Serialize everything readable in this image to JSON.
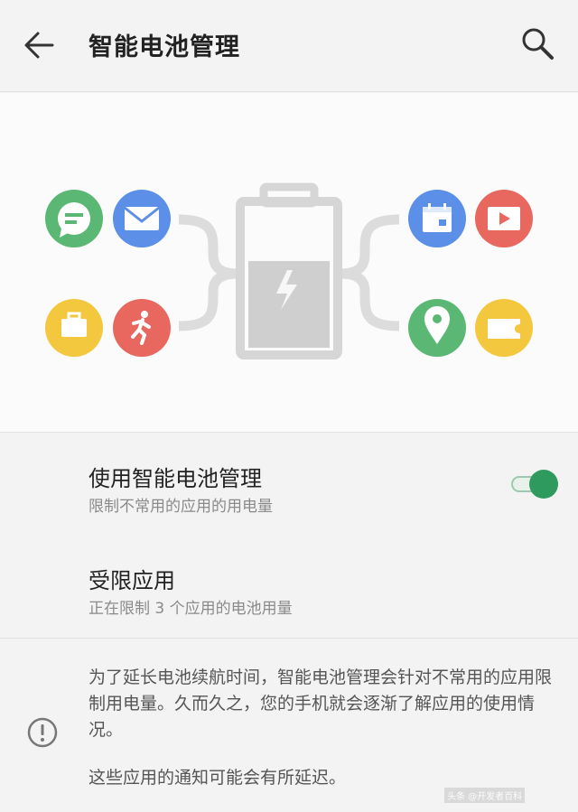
{
  "header": {
    "title": "智能电池管理",
    "back_icon": "arrow-left-icon",
    "search_icon": "search-icon"
  },
  "illustration": {
    "left_apps": [
      "message-icon",
      "mail-icon",
      "briefcase-icon",
      "running-icon"
    ],
    "right_apps": [
      "calendar-icon",
      "video-icon",
      "location-icon",
      "ticket-icon"
    ],
    "center_icon": "battery-charging-icon",
    "colors": {
      "green": "#5ab874",
      "blue": "#5b8fe8",
      "yellow": "#f3c83f",
      "red": "#e8675f",
      "battery_gray": "#d3d3d3"
    }
  },
  "settings": {
    "smart_battery": {
      "title": "使用智能电池管理",
      "subtitle": "限制不常用的应用的用电量",
      "enabled": true,
      "accent_color": "#2f9a5d"
    },
    "restricted_apps": {
      "title": "受限应用",
      "subtitle": "正在限制 3 个应用的电池用量"
    }
  },
  "info": {
    "icon": "info-circle-icon",
    "description": "为了延长电池续航时间，智能电池管理会针对不常用的应用限制用电量。久而久之，您的手机就会逐渐了解应用的使用情况。",
    "note": "这些应用的通知可能会有所延迟。"
  },
  "watermark": "头条 @开发者百科"
}
